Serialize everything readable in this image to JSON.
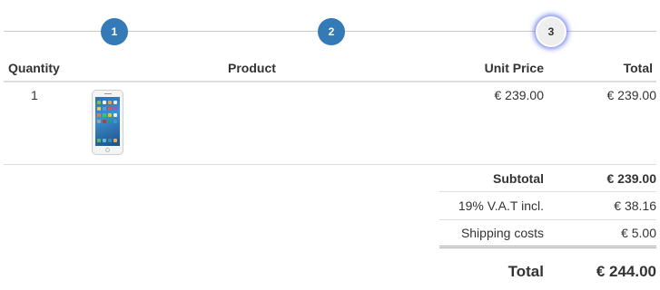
{
  "steps": [
    {
      "number": "1",
      "state": "done"
    },
    {
      "number": "2",
      "state": "done"
    },
    {
      "number": "3",
      "state": "current"
    }
  ],
  "table": {
    "headers": {
      "quantity": "Quantity",
      "product": "Product",
      "unit_price": "Unit Price",
      "total": "Total"
    },
    "rows": [
      {
        "quantity": "1",
        "product_image": "iphone-image",
        "unit_price": "€ 239.00",
        "total": "€ 239.00"
      }
    ]
  },
  "summary": {
    "subtotal_label": "Subtotal",
    "subtotal_value": "€ 239.00",
    "vat_label": "19% V.A.T incl.",
    "vat_value": "€ 38.16",
    "shipping_label": "Shipping costs",
    "shipping_value": "€ 5.00",
    "total_label": "Total",
    "total_value": "€ 244.00"
  },
  "colors": {
    "step_done": "#337ab7",
    "step_current": "#eeeeee",
    "step_glow": "#5a6ee6"
  }
}
